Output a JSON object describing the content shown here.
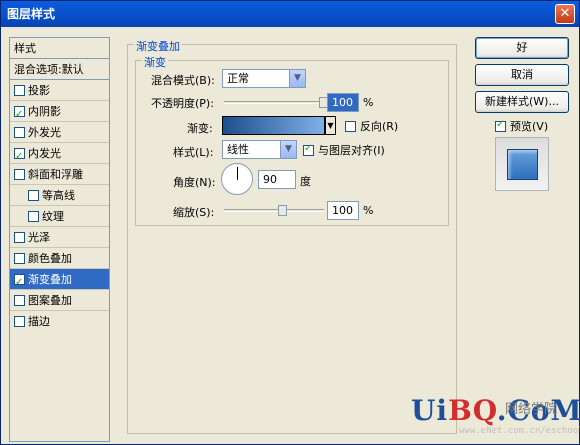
{
  "window": {
    "title": "图层样式",
    "close_label": "✕"
  },
  "styles_panel": {
    "header": "样式",
    "items": [
      {
        "label": "混合选项:默认",
        "checkbox": false
      },
      {
        "label": "投影",
        "checked": false
      },
      {
        "label": "内阴影",
        "checked": true
      },
      {
        "label": "外发光",
        "checked": false
      },
      {
        "label": "内发光",
        "checked": true
      },
      {
        "label": "斜面和浮雕",
        "checked": false
      },
      {
        "label": "等高线",
        "checked": false,
        "indent": true
      },
      {
        "label": "纹理",
        "checked": false,
        "indent": true
      },
      {
        "label": "光泽",
        "checked": false
      },
      {
        "label": "颜色叠加",
        "checked": false
      },
      {
        "label": "渐变叠加",
        "checked": true,
        "active": true
      },
      {
        "label": "图案叠加",
        "checked": false
      },
      {
        "label": "描边",
        "checked": false
      }
    ]
  },
  "gradient_overlay": {
    "group_title": "渐变叠加",
    "subgroup_title": "渐变",
    "blend_mode_label": "混合模式(B):",
    "blend_mode_value": "正常",
    "opacity_label": "不透明度(P):",
    "opacity_value": "100",
    "opacity_percent": 100,
    "percent_symbol": "%",
    "gradient_label": "渐变:",
    "reverse_label": "反向(R)",
    "reverse_checked": false,
    "style_label": "样式(L):",
    "style_value": "线性",
    "align_label": "与图层对齐(I)",
    "align_checked": true,
    "angle_label": "角度(N):",
    "angle_value": "90",
    "angle_unit": "度",
    "scale_label": "缩放(S):",
    "scale_value": "100",
    "scale_percent": 100
  },
  "buttons": {
    "ok": "好",
    "cancel": "取消",
    "new_style": "新建样式(W)...",
    "preview_label": "预览(V)",
    "preview_checked": true
  },
  "watermark": {
    "logo_a": "Ui",
    "logo_b": "BQ",
    "logo_c": ".CoM",
    "cn": "网络学院",
    "url": "www.eNet.com.cn/eschool"
  },
  "colors": {
    "title_bar": "#0a52cc",
    "selection": "#316ac5",
    "gradient_start": "#1c4f8c",
    "gradient_end": "#7fb0e8"
  }
}
